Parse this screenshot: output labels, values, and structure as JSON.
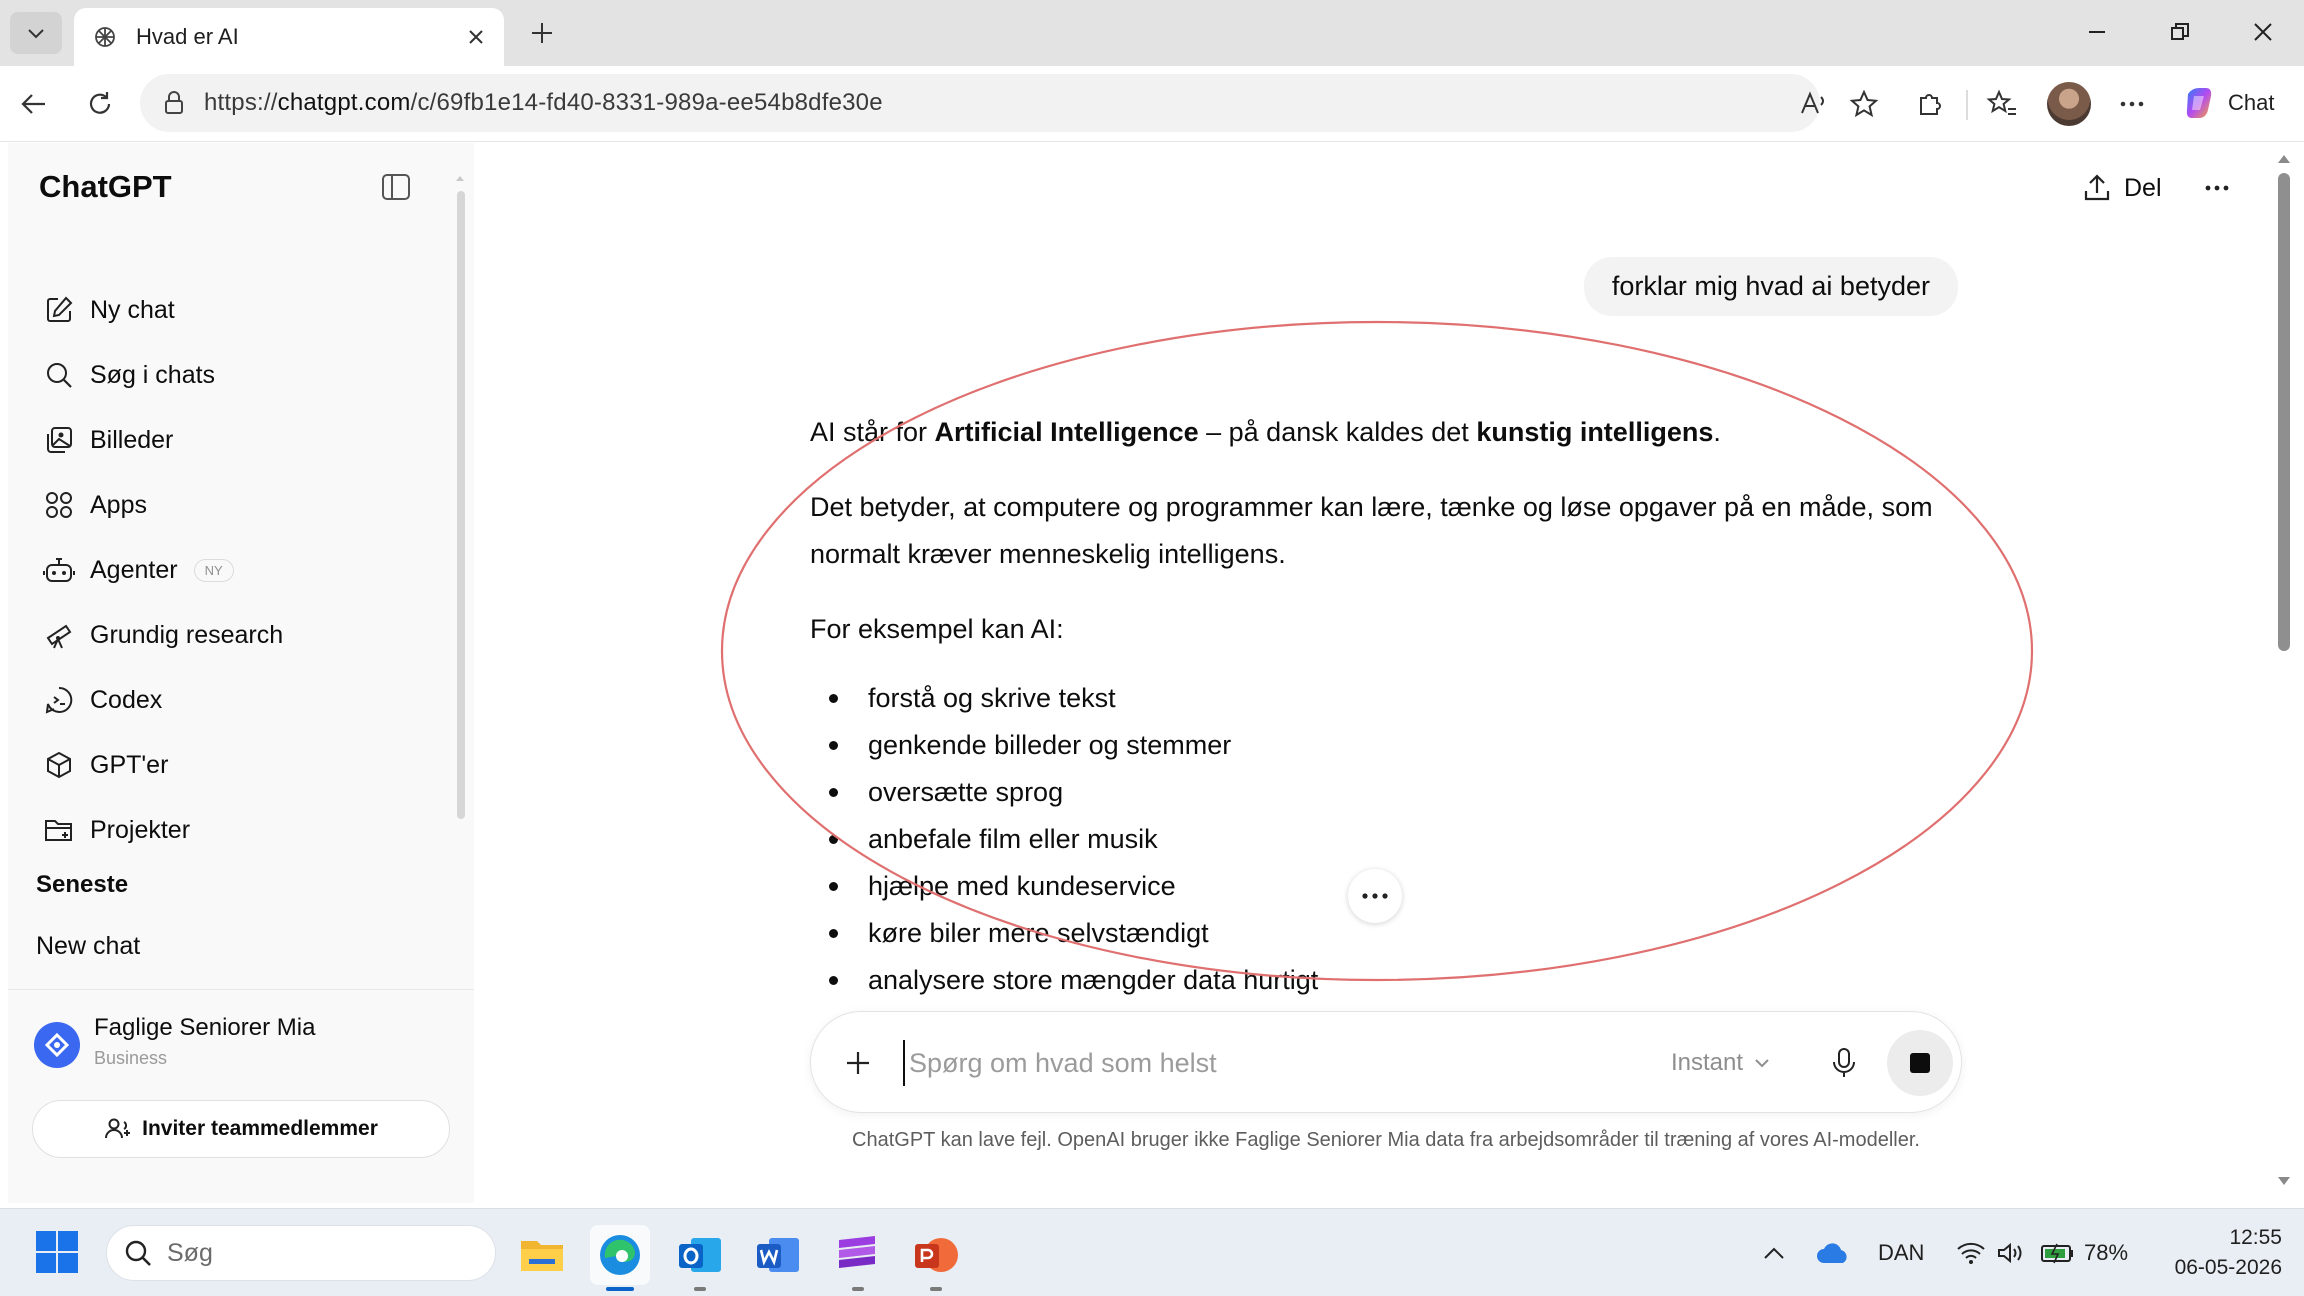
{
  "browser": {
    "tab_title": "Hvad er AI",
    "url_prefix": "https://",
    "url_domain": "chatgpt.com",
    "url_path": "/c/69fb1e14-fd40-8331-989a-ee54b8dfe30e",
    "copilot_label": "Chat"
  },
  "sidebar": {
    "brand": "ChatGPT",
    "items": [
      {
        "label": "Ny chat",
        "icon": "new-chat-icon"
      },
      {
        "label": "Søg i chats",
        "icon": "search-icon"
      },
      {
        "label": "Billeder",
        "icon": "images-icon"
      },
      {
        "label": "Apps",
        "icon": "apps-icon"
      },
      {
        "label": "Agenter",
        "icon": "agent-icon",
        "badge": "NY"
      },
      {
        "label": "Grundig research",
        "icon": "telescope-icon"
      },
      {
        "label": "Codex",
        "icon": "codex-icon"
      },
      {
        "label": "GPT'er",
        "icon": "cube-icon"
      },
      {
        "label": "Projekter",
        "icon": "folder-icon"
      }
    ],
    "recent_heading": "Seneste",
    "recent": [
      "New chat"
    ],
    "workspace": {
      "name": "Faglige Seniorer Mia",
      "plan": "Business"
    },
    "invite_label": "Inviter teammedlemmer"
  },
  "header": {
    "share_label": "Del"
  },
  "conversation": {
    "user_message": "forklar mig hvad ai betyder",
    "answer": {
      "p1": {
        "before": "AI står for ",
        "bold1": "Artificial Intelligence",
        "middle": " – på dansk kaldes det ",
        "bold2": "kunstig intelligens",
        "after": "."
      },
      "p2": "Det betyder, at computere og programmer kan lære, tænke og løse opgaver på en måde, som normalt kræver menneskelig intelligens.",
      "p3": "For eksempel kan AI:",
      "bullets": [
        "forstå og skrive tekst",
        "genkende billeder og stemmer",
        "oversætte sprog",
        "anbefale film eller musik",
        "hjælpe med kundeservice",
        "køre biler mere selvstændigt",
        "analysere store mængder data hurtigt"
      ]
    }
  },
  "composer": {
    "placeholder": "Spørg om hvad som helst",
    "value": "",
    "model": "Instant"
  },
  "disclaimer": "ChatGPT kan lave fejl. OpenAI bruger ikke Faglige Seniorer Mia data fra arbejdsområder til træning af vores AI-modeller.",
  "taskbar": {
    "search_placeholder": "Søg",
    "apps": [
      "file-explorer",
      "edge",
      "outlook",
      "word",
      "onenote",
      "powerpoint"
    ],
    "language": "DAN",
    "battery": "78%",
    "time": "12:55",
    "date": "06-05-2026"
  },
  "colors": {
    "annotation": "#e07070",
    "workspace_logo": "#3b68f0",
    "taskbar_accent": "#0a63c9"
  }
}
